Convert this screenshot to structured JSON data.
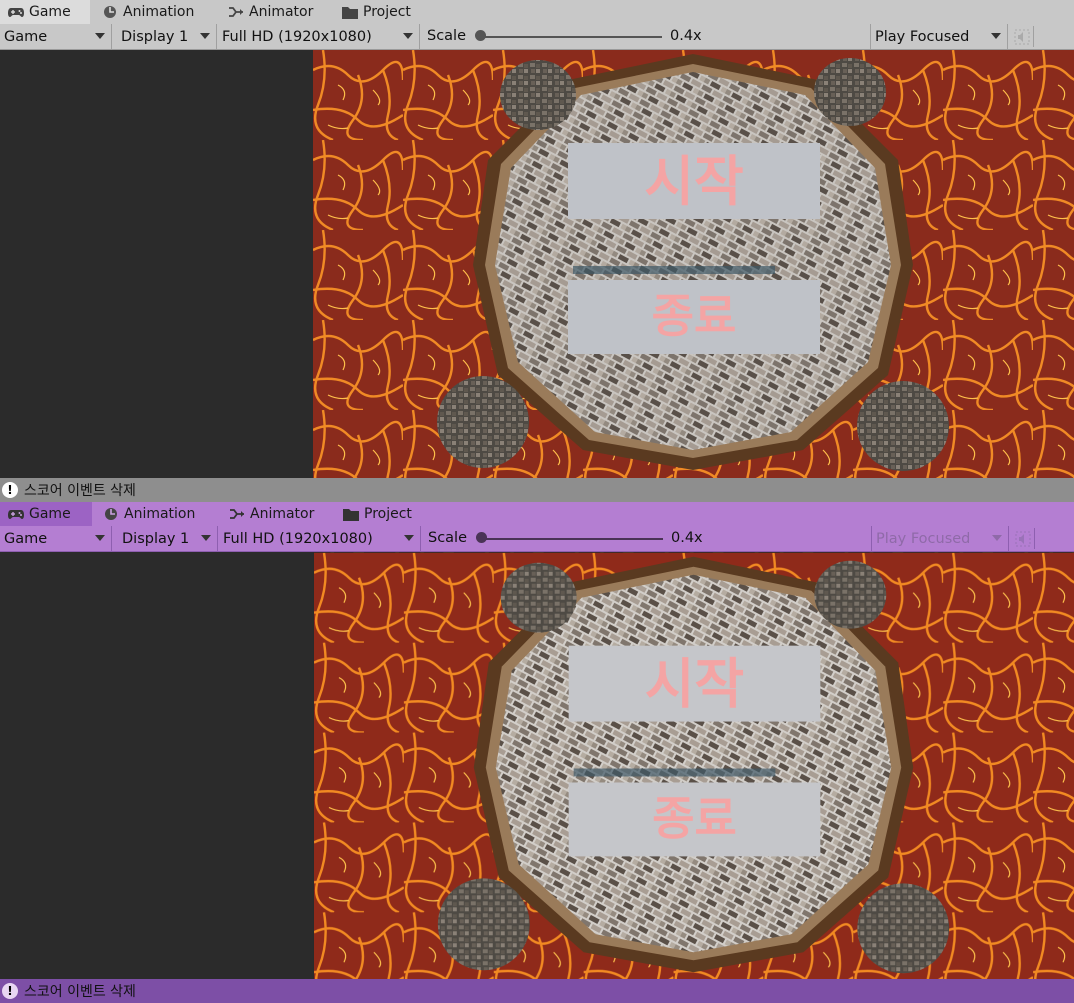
{
  "panels": [
    {
      "id": "top",
      "theme": {
        "bar_bg": "#c8c8c8",
        "tab_active_bg": "#dcdcdc",
        "status_bg": "#8e8e8e",
        "text": "#1a1a1a"
      },
      "tabs": [
        {
          "label": "Game",
          "icon": "gamepad-icon",
          "active": true
        },
        {
          "label": "Animation",
          "icon": "clock-icon",
          "active": false
        },
        {
          "label": "Animator",
          "icon": "animator-icon",
          "active": false
        },
        {
          "label": "Project",
          "icon": "folder-icon",
          "active": false
        }
      ],
      "toolbar": {
        "view_select": "Game",
        "display_select": "Display 1",
        "resolution_select": "Full HD (1920x1080)",
        "scale_label": "Scale",
        "scale_value": "0.4x",
        "play_mode_select": "Play Focused",
        "play_mode_disabled": false
      },
      "game_view": {
        "start_button": "시작",
        "quit_button": "종료"
      },
      "status_message": "스코어 이벤트 삭제"
    },
    {
      "id": "bottom",
      "theme": {
        "bar_bg": "#b47ed2",
        "tab_active_bg": "#9c63c4",
        "status_bg": "#7d4fa6",
        "text": "#1a1a1a"
      },
      "tabs": [
        {
          "label": "Game",
          "icon": "gamepad-icon",
          "active": true
        },
        {
          "label": "Animation",
          "icon": "clock-icon",
          "active": false
        },
        {
          "label": "Animator",
          "icon": "animator-icon",
          "active": false
        },
        {
          "label": "Project",
          "icon": "folder-icon",
          "active": false
        }
      ],
      "toolbar": {
        "view_select": "Game",
        "display_select": "Display 1",
        "resolution_select": "Full HD (1920x1080)",
        "scale_label": "Scale",
        "scale_value": "0.4x",
        "play_mode_select": "Play Focused",
        "play_mode_disabled": true
      },
      "game_view": {
        "start_button": "시작",
        "quit_button": "종료"
      },
      "status_message": "스코어 이벤트 삭제"
    }
  ]
}
